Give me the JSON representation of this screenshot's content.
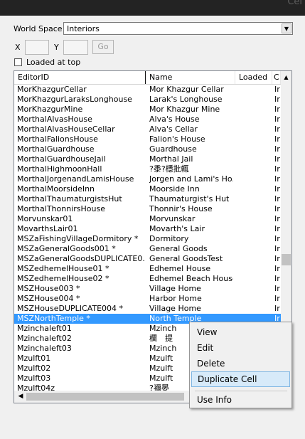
{
  "window": {
    "title_ghost": "Cel"
  },
  "worldspace": {
    "label": "World Space",
    "value": "Interiors"
  },
  "coords": {
    "x_label": "X",
    "y_label": "Y",
    "x_value": "",
    "y_value": "",
    "go_label": "Go"
  },
  "options": {
    "loaded_at_top_label": "Loaded at top",
    "loaded_at_top_checked": false
  },
  "table": {
    "columns": [
      "EditorID",
      "Name",
      "Loaded",
      "C"
    ],
    "rows": [
      {
        "editor_id": "MorKhazgurCellar",
        "name": "Mor Khazgur Cellar",
        "c": "Ir"
      },
      {
        "editor_id": "MorKhazgurLaraksLonghouse",
        "name": "Larak's Longhouse",
        "c": "Ir"
      },
      {
        "editor_id": "MorKhazgurMine",
        "name": "Mor Khazgur Mine",
        "c": "Ir"
      },
      {
        "editor_id": "MorthalAlvasHouse",
        "name": "Alva's House",
        "c": "Ir"
      },
      {
        "editor_id": "MorthalAlvasHouseCellar",
        "name": "Alva's Cellar",
        "c": "Ir"
      },
      {
        "editor_id": "MorthalFalionsHouse",
        "name": "Falion's House",
        "c": "Ir"
      },
      {
        "editor_id": "MorthalGuardhouse",
        "name": "Guardhouse",
        "c": "Ir"
      },
      {
        "editor_id": "MorthalGuardhouseJail",
        "name": "Morthal Jail",
        "c": "Ir"
      },
      {
        "editor_id": "MorthalHighmoonHall",
        "name": "?黍?檼批輒",
        "c": "Ir"
      },
      {
        "editor_id": "MorthalJorgenandLamisHouse",
        "name": "Jorgen and Lami's Ho...",
        "c": "Ir"
      },
      {
        "editor_id": "MorthalMoorsideInn",
        "name": "Moorside Inn",
        "c": "Ir"
      },
      {
        "editor_id": "MorthalThaumaturgistsHut",
        "name": "Thaumaturgist's Hut",
        "c": "Ir"
      },
      {
        "editor_id": "MorthalThonnirsHouse",
        "name": "Thonnir's House",
        "c": "Ir"
      },
      {
        "editor_id": "Morvunskar01",
        "name": "Morvunskar",
        "c": "Ir"
      },
      {
        "editor_id": "MovarthsLair01",
        "name": "Movarth's Lair",
        "c": "Ir"
      },
      {
        "editor_id": "MSZaFishingVillageDormitory *",
        "name": "Dormitory",
        "c": "Ir"
      },
      {
        "editor_id": "MSZaGeneralGoods001 *",
        "name": "General Goods",
        "c": "Ir"
      },
      {
        "editor_id": "MSZaGeneralGoodsDUPLICATE0...",
        "name": "General GoodsTest",
        "c": "Ir"
      },
      {
        "editor_id": "MSZedhemelHouse01 *",
        "name": "Edhemel House",
        "c": "Ir"
      },
      {
        "editor_id": "MSZedhemelHouse02 *",
        "name": "Edhemel Beach House",
        "c": "Ir"
      },
      {
        "editor_id": "MSZHouse003 *",
        "name": "Village Home",
        "c": "Ir"
      },
      {
        "editor_id": "MSZHouse004 *",
        "name": "Harbor Home",
        "c": "Ir"
      },
      {
        "editor_id": "MSZHouseDUPLICATE004 *",
        "name": "Village Home",
        "c": "Ir"
      },
      {
        "editor_id": "MSZNorthTemple *",
        "name": "North Temple",
        "c": "Ir",
        "selected": true
      },
      {
        "editor_id": "Mzinchaleft01",
        "name": "Mzinch",
        "c": "Ir"
      },
      {
        "editor_id": "Mzinchaleft02",
        "name": "欄　提",
        "c": "Ir"
      },
      {
        "editor_id": "Mzinchaleft03",
        "name": "Mzinch",
        "c": "Ir"
      },
      {
        "editor_id": "Mzulft01",
        "name": "Mzulft",
        "c": "Ir"
      },
      {
        "editor_id": "Mzulft02",
        "name": "Mzulft",
        "c": "Ir"
      },
      {
        "editor_id": "Mzulft03",
        "name": "Mzulft",
        "c": "Ir"
      },
      {
        "editor_id": "Mzulft04z",
        "name": "?禰晏",
        "c": "Ir"
      }
    ]
  },
  "context_menu": {
    "items": [
      {
        "label": "View",
        "highlighted": false
      },
      {
        "label": "Edit",
        "highlighted": false
      },
      {
        "label": "Delete",
        "highlighted": false
      },
      {
        "label": "Duplicate Cell",
        "highlighted": true
      },
      {
        "label": "Use Info",
        "highlighted": false
      }
    ]
  },
  "colors": {
    "selection": "#3399ff",
    "menu_highlight": "#d7eaf9",
    "panel": "#f0f0f0",
    "titlebar": "#232323"
  }
}
